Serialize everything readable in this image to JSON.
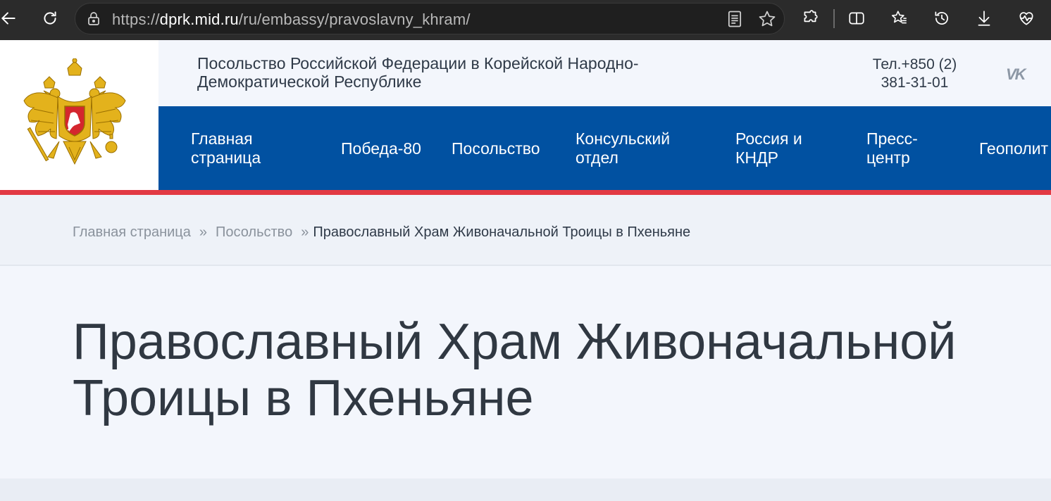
{
  "browser": {
    "url_scheme": "https://",
    "url_host": "dprk.mid.ru",
    "url_path": "/ru/embassy/pravoslavny_khram/",
    "icons": [
      "back-icon",
      "reload-icon",
      "lock-icon",
      "reader-view-icon",
      "favorite-star-icon",
      "extensions-icon",
      "split-screen-icon",
      "favorites-icon",
      "history-icon",
      "downloads-icon",
      "health-icon"
    ]
  },
  "header": {
    "embassy_name": "Посольство Российской Федерации в Корейской Народно-Демократической Республике",
    "phone_line1": "Тел.+850 (2)",
    "phone_line2": "381-31-01",
    "social": "VK",
    "logo": "coat-of-arms-russia"
  },
  "nav": {
    "items": [
      {
        "label": "Главная страница"
      },
      {
        "label": "Победа-80"
      },
      {
        "label": "Посольство"
      },
      {
        "label": "Консульский отдел"
      },
      {
        "label": "Россия и КНДР"
      },
      {
        "label": "Пресс-центр"
      },
      {
        "label": "Геополит"
      }
    ]
  },
  "breadcrumb": {
    "items": [
      "Главная страница",
      "Посольство"
    ],
    "separator": "»",
    "current": "Православный Храм Живоначальной Троицы в Пхеньяне"
  },
  "page": {
    "title": "Православный Храм Живоначальной Троицы в Пхеньяне"
  },
  "colors": {
    "nav_blue": "#0151a1",
    "accent_red": "#e23a44",
    "gold": "#e3b21c"
  }
}
